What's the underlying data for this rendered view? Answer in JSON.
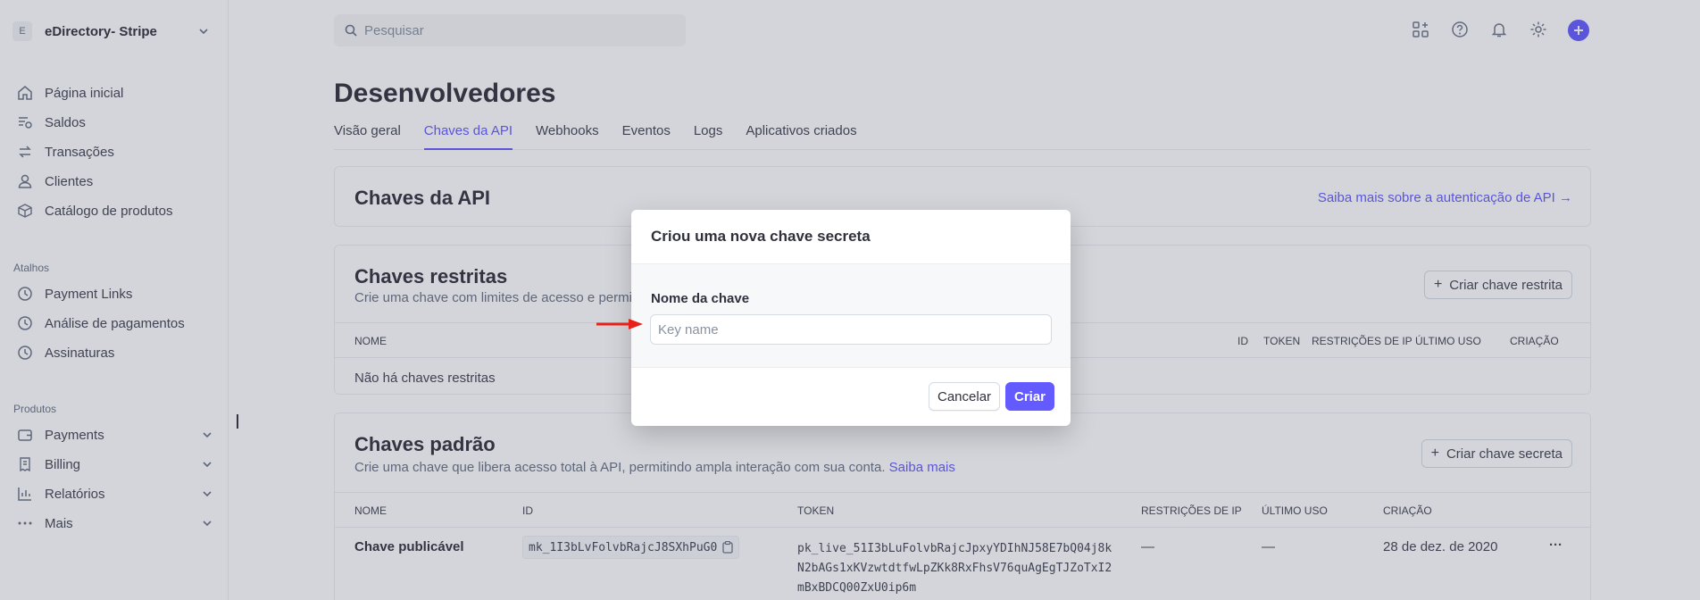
{
  "account": {
    "initial": "E",
    "name": "eDirectory- Stripe"
  },
  "nav": {
    "main": [
      {
        "label": "Página inicial",
        "icon": "home-icon"
      },
      {
        "label": "Saldos",
        "icon": "balance-icon"
      },
      {
        "label": "Transações",
        "icon": "transfer-icon"
      },
      {
        "label": "Clientes",
        "icon": "person-icon"
      },
      {
        "label": "Catálogo de produtos",
        "icon": "box-icon"
      }
    ],
    "shortcuts_header": "Atalhos",
    "shortcuts": [
      {
        "label": "Payment Links",
        "icon": "clock-icon"
      },
      {
        "label": "Análise de pagamentos",
        "icon": "clock-icon"
      },
      {
        "label": "Assinaturas",
        "icon": "clock-icon"
      }
    ],
    "products_header": "Produtos",
    "products": [
      {
        "label": "Payments",
        "icon": "wallet-icon"
      },
      {
        "label": "Billing",
        "icon": "billing-icon"
      },
      {
        "label": "Relatórios",
        "icon": "chart-icon"
      },
      {
        "label": "Mais",
        "icon": "more-icon"
      }
    ]
  },
  "search": {
    "placeholder": "Pesquisar"
  },
  "page": {
    "title": "Desenvolvedores",
    "tabs": [
      "Visão geral",
      "Chaves da API",
      "Webhooks",
      "Eventos",
      "Logs",
      "Aplicativos criados"
    ],
    "active_tab": "Chaves da API"
  },
  "api_card": {
    "title": "Chaves da API",
    "link": "Saiba mais sobre a autenticação de API →"
  },
  "restricted": {
    "title": "Chaves restritas",
    "subtitle": "Crie uma chave com limites de acesso e permis",
    "button": "Criar chave restrita",
    "headers": [
      "NOME",
      "ID",
      "TOKEN",
      "RESTRIÇÕES DE IP",
      "ÚLTIMO USO",
      "CRIAÇÃO"
    ],
    "empty": "Não há chaves restritas"
  },
  "standard": {
    "title": "Chaves padrão",
    "subtitle": "Crie uma chave que libera acesso total à API, permitindo ampla interação com sua conta.",
    "subtitle_link": "Saiba mais",
    "button": "Criar chave secreta",
    "headers": [
      "NOME",
      "ID",
      "TOKEN",
      "RESTRIÇÕES DE IP",
      "ÚLTIMO USO",
      "CRIAÇÃO"
    ],
    "row": {
      "name": "Chave publicável",
      "id": "mk_1I3bLvFolvbRajcJ8SXhPuG0",
      "token_lines": [
        "pk_live_51I3bLuFolvbRajcJpxyYDIhNJ58E7bQ04j8k",
        "N2bAGs1xKVzwtdtfwLpZKk8RxFhsV76quAgEgTJZoTxI2",
        "mBxBDCQ00ZxU0ip6m"
      ],
      "ip": "—",
      "last_used": "—",
      "created": "28 de dez. de 2020",
      "menu": "···"
    }
  },
  "modal": {
    "title": "Criou uma nova chave secreta",
    "field_label": "Nome da chave",
    "field_placeholder": "Key name",
    "field_value": "",
    "cancel": "Cancelar",
    "create": "Criar"
  },
  "colors": {
    "accent": "#635bff",
    "annotation_arrow": "#e8201a"
  }
}
